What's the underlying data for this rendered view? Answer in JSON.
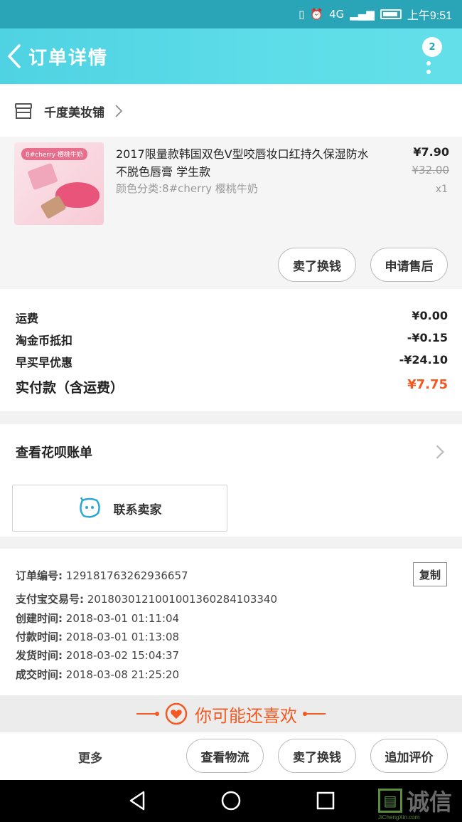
{
  "status_bar": {
    "network": "4G",
    "time": "上午9:51"
  },
  "header": {
    "title": "订单详情",
    "badge_count": "2"
  },
  "shop": {
    "name": "千度美妆铺"
  },
  "item": {
    "title": "2017限量款韩国双色V型咬唇妆口红持久保湿防水不脱色唇膏 学生款",
    "spec": "颜色分类:8#cherry 樱桃牛奶",
    "price": "¥7.90",
    "original_price": "¥32.00",
    "quantity": "x1",
    "image_tag": "8#cherry 樱桃牛奶",
    "buttons": {
      "resell": "卖了换钱",
      "after_sale": "申请售后"
    }
  },
  "fees": [
    {
      "label": "运费",
      "value": "¥0.00"
    },
    {
      "label": "淘金币抵扣",
      "value": "-¥0.15"
    },
    {
      "label": "早买早优惠",
      "value": "-¥24.10"
    }
  ],
  "total": {
    "label": "实付款（含运费）",
    "value": "¥7.75"
  },
  "huabei": {
    "label": "查看花呗账单"
  },
  "contact": {
    "label": "联系卖家"
  },
  "order_info": {
    "copy_label": "复制",
    "lines": [
      {
        "label": "订单编号:",
        "value": "129181763262936657"
      },
      {
        "label": "支付宝交易号:",
        "value": "2018030121001001360284103340"
      },
      {
        "label": "创建时间:",
        "value": "2018-03-01 01:11:04"
      },
      {
        "label": "付款时间:",
        "value": "2018-03-01 01:13:08"
      },
      {
        "label": "发货时间:",
        "value": "2018-03-02 15:04:37"
      },
      {
        "label": "成交时间:",
        "value": "2018-03-08 21:25:20"
      }
    ]
  },
  "recommend": {
    "title": "你可能还喜欢"
  },
  "bottom_bar": {
    "more": "更多",
    "logistics": "查看物流",
    "resell": "卖了换钱",
    "review": "追加评价"
  },
  "watermark": {
    "text": "诚信",
    "sub": "JiChengXin.com"
  },
  "colors": {
    "accent": "#4fd2e2",
    "price_orange": "#f25a22"
  }
}
